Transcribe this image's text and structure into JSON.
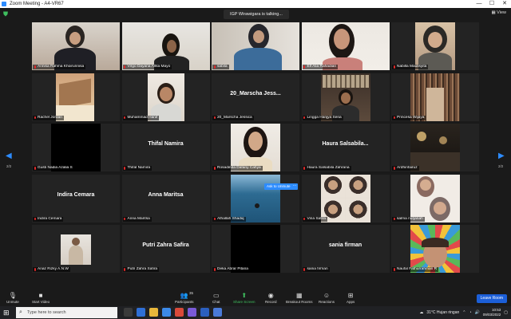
{
  "window": {
    "title": "Zoom Meeting - A4-VR67",
    "minimize": "—",
    "maximize": "☐",
    "close": "✕"
  },
  "meeting": {
    "speaking": "IGP Wirawigara is talking...",
    "view_label": "View",
    "page_left": "2/2",
    "page_right": "2/2"
  },
  "tiles": [
    {
      "label": "Annisa Rahma Khoirunnisa"
    },
    {
      "label": "Virgo Dayana Alfita Mayo"
    },
    {
      "label": "sabila"
    },
    {
      "label": "Elf Alia Rahadian"
    },
    {
      "label": "Nabilla Maulisyita"
    },
    {
      "label": "Rachel Jordan"
    },
    {
      "label": "Muhammad Hanif"
    },
    {
      "label": "20_Marscha Jessica",
      "name": "20_Marscha Jess..."
    },
    {
      "label": "Lingga Hanjya Sena"
    },
    {
      "label": "Princesa Wijaya"
    },
    {
      "label": "Gusti Nadia Azalia S"
    },
    {
      "label": "Thifal Namira",
      "name": "Thifal Namira"
    },
    {
      "label": "Rosadinda Dafany Cahya"
    },
    {
      "label": "Haura Salsabila Zahrana",
      "name": "Haura  Salsabila..."
    },
    {
      "label": "Ardhinfairuz"
    },
    {
      "label": "Indira Cemara",
      "name": "Indira Cemara"
    },
    {
      "label": "Anna Maritsa",
      "name": "Anna Maritsa"
    },
    {
      "label": "Athallah Shadiq"
    },
    {
      "label": "Vina Safira"
    },
    {
      "label": "salma nurjanah"
    },
    {
      "label": "Anaz Rizky A.N.W"
    },
    {
      "label": "Putri Zahra Safira",
      "name": "Putri Zahra Safira"
    },
    {
      "label": "Deka Abrar Pitana"
    },
    {
      "label": "sania firman",
      "name": "sania firman"
    },
    {
      "label": "Naufal Fathurrahman R"
    }
  ],
  "ask_to_unmute": {
    "label": "Ask to Unmute",
    "more": "···"
  },
  "toolbar": {
    "unmute": "Unmute",
    "start_video": "Start Video",
    "participants": "Participants",
    "participants_count": "35",
    "chat": "Chat",
    "share_screen": "Share Screen",
    "record": "Record",
    "breakout": "Breakout Rooms",
    "reactions": "Reactions",
    "apps": "Apps",
    "leave": "Leave Room"
  },
  "taskbar": {
    "search_placeholder": "Type here to search",
    "weather": "31°C  Hujan ringan",
    "time": "10:53",
    "date": "09/03/2022"
  }
}
